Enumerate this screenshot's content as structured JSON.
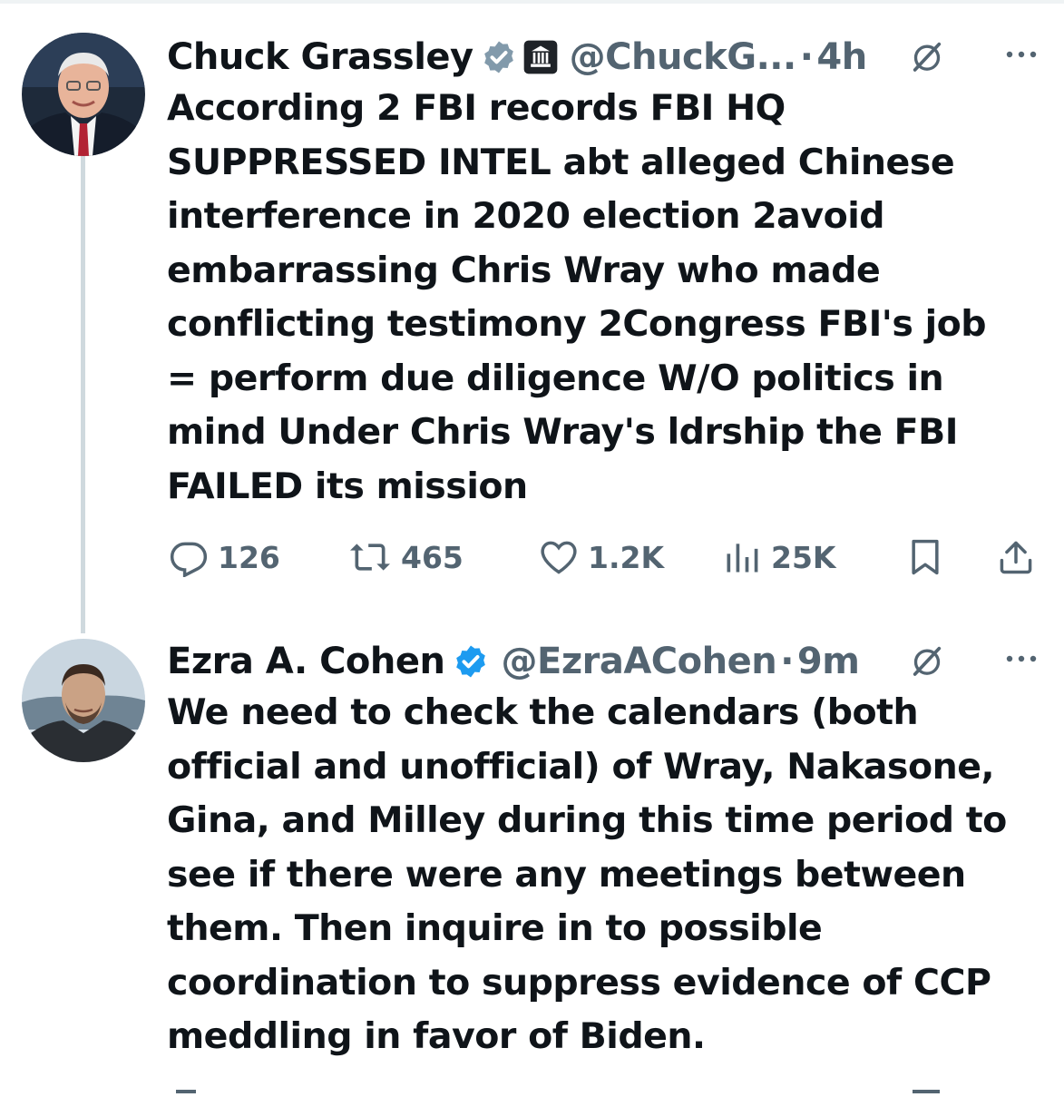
{
  "tweets": [
    {
      "author_name": "Chuck Grassley",
      "handle": "@ChuckG...",
      "separator": "·",
      "time": "4h",
      "verified": true,
      "verified_color": "#829aab",
      "government_badge": true,
      "text": "According 2 FBI records FBI HQ\nSUPPRESSED INTEL abt alleged Chinese\ninterference in 2020 election 2avoid\nembarrassing Chris Wray who made\nconflicting testimony 2Congress FBI's job\n= perform due diligence W/O politics in\nmind Under Chris Wray's ldrship the FBI\nFAILED its mission",
      "actions": {
        "replies": "126",
        "reposts": "465",
        "likes": "1.2K",
        "views": "25K"
      }
    },
    {
      "author_name": "Ezra A. Cohen",
      "handle": "@EzraACohen",
      "separator": "·",
      "time": "9m",
      "verified": true,
      "verified_color": "#1d9bf0",
      "text": "We need to check the calendars (both\nofficial and unofficial) of Wray, Nakasone,\nGina, and Milley during this time period to\nsee if there were any meetings between\nthem. Then inquire in to possible\ncoordination to suppress evidence of CCP\nmeddling in favor of Biden."
    }
  ],
  "icons": {
    "reply": "reply-icon",
    "repost": "repost-icon",
    "like": "like-icon",
    "views": "views-icon",
    "bookmark": "bookmark-icon",
    "share": "share-icon",
    "grok": "grok-icon",
    "more": "more-icon"
  },
  "colors": {
    "text": "#0f1419",
    "secondary": "#536471",
    "thread_line": "#cfd9de"
  }
}
